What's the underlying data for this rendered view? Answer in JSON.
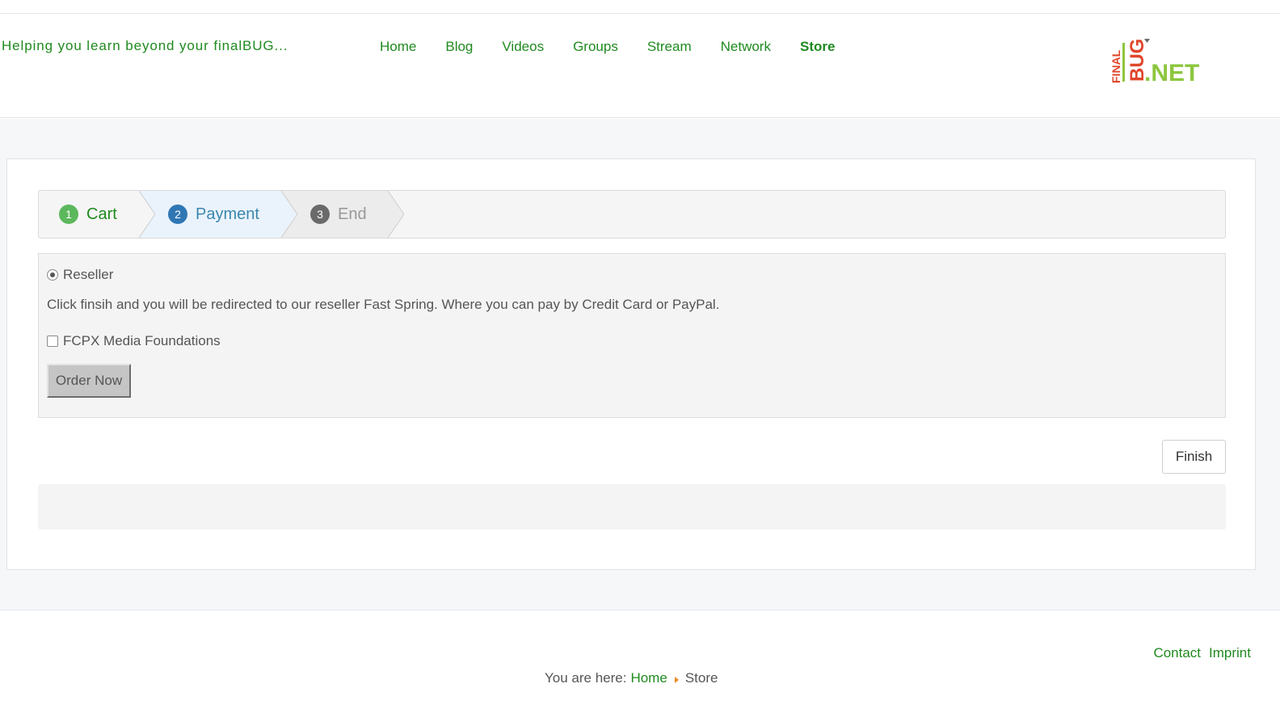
{
  "header": {
    "tagline": "Helping you learn beyond your finalBUG...",
    "nav": [
      {
        "label": "Home"
      },
      {
        "label": "Blog"
      },
      {
        "label": "Videos"
      },
      {
        "label": "Groups"
      },
      {
        "label": "Stream"
      },
      {
        "label": "Network"
      },
      {
        "label": "Store",
        "active": true
      }
    ],
    "logo": {
      "word_final": "FINAL",
      "word_bug": "BUG",
      "word_net": ".NET"
    }
  },
  "checkout": {
    "steps": [
      {
        "number": "1",
        "label": "Cart",
        "state": "done"
      },
      {
        "number": "2",
        "label": "Payment",
        "state": "current"
      },
      {
        "number": "3",
        "label": "End",
        "state": "pending"
      }
    ],
    "payment": {
      "method_label": "Reseller",
      "method_selected": true,
      "info": "Click finsih and you will be redirected to our reseller Fast Spring. Where you can pay by Credit Card or PayPal.",
      "product_label": "FCPX Media Foundations",
      "product_checked": false,
      "order_button": "Order Now"
    },
    "finish_button": "Finish"
  },
  "footer": {
    "links": [
      {
        "label": "Contact"
      },
      {
        "label": "Imprint"
      }
    ],
    "breadcrumb": {
      "prefix": "You are here:",
      "home": "Home",
      "current": "Store"
    }
  },
  "colors": {
    "link": "#1f8a1f",
    "step_done": "#5cb85c",
    "step_current": "#2f77b4",
    "step_pending": "#6a6a6a",
    "breadcrumb_sep": "#f08a24"
  }
}
